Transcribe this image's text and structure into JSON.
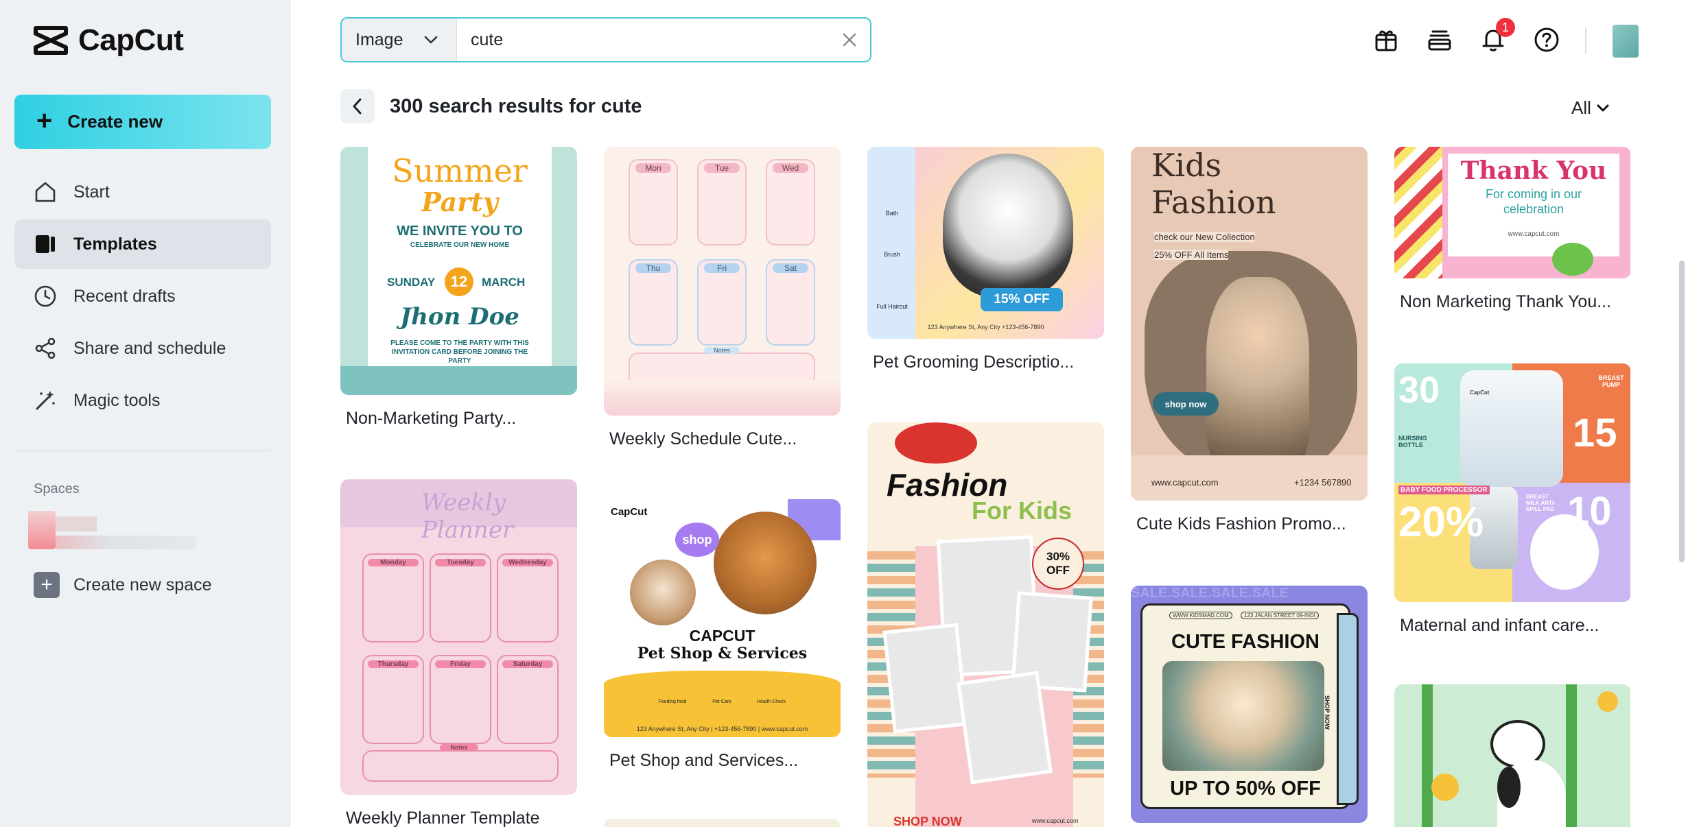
{
  "app": {
    "name": "CapCut"
  },
  "sidebar": {
    "create_label": "Create new",
    "items": [
      {
        "label": "Start",
        "icon": "home-icon"
      },
      {
        "label": "Templates",
        "icon": "templates-icon",
        "active": true
      },
      {
        "label": "Recent drafts",
        "icon": "clock-icon"
      },
      {
        "label": "Share and schedule",
        "icon": "share-icon"
      },
      {
        "label": "Magic tools",
        "icon": "magic-wand-icon"
      }
    ],
    "spaces_title": "Spaces",
    "new_space_label": "Create new space"
  },
  "search": {
    "type_label": "Image",
    "query": "cute"
  },
  "header": {
    "notification_count": "1"
  },
  "results": {
    "title": "300 search results for cute",
    "filter_label": "All"
  },
  "colors": {
    "accent": "#2fd0e3",
    "badge": "#f0303f"
  },
  "cards": [
    {
      "caption": "Non-Marketing Party...",
      "t1": "Summer",
      "t2": "Party",
      "t3": "WE INVITE YOU TO",
      "t4": "CELEBRATE OUR NEW HOME",
      "t5": "SUNDAY",
      "t6": "12",
      "t7": "MARCH",
      "t8": "Jhon Doe",
      "t9": "PLEASE COME TO THE PARTY WITH THIS INVITATION CARD BEFORE JOINING THE PARTY"
    },
    {
      "caption": "Weekly Planner Template",
      "t1": "Weekly Planner",
      "days": [
        "Monday",
        "Tuesday",
        "Wednesday",
        "Thursday",
        "Friday",
        "Saturday"
      ],
      "notes": "Notes"
    },
    {
      "caption": "Weekly Schedule Cute...",
      "days": [
        "Mon",
        "Tue",
        "Wed",
        "Thu",
        "Fri",
        "Sat"
      ],
      "notes": "Notes"
    },
    {
      "caption": "Pet Shop and Services...",
      "brand": "CapCut",
      "t1": "shop",
      "t2": "CAPCUT",
      "t3": "Pet Shop & Services",
      "services": [
        "Feeding food",
        "Pet Care",
        "Health Check"
      ],
      "footer": "123 Anywhere St, Any City  |  +123-456-7890  |  www.capcut.com"
    },
    {
      "caption": "Pet Grooming Descriptio...",
      "services": [
        "Bath",
        "Brush",
        "Full Haircut"
      ],
      "t1": "15% OFF",
      "footer": "123 Anywhere St, Any City   +123-456-7890"
    },
    {
      "caption": "",
      "t1": "Fashion",
      "t2": "For Kids",
      "t3": "30% OFF",
      "t4": "SHOP NOW",
      "t5": "www.capcut.com"
    },
    {
      "caption": "Cute Kids Fashion Promo...",
      "t1": "Kids",
      "t2": "Fashion",
      "t3": "check our New Collection",
      "t4": "25% OFF All Items",
      "t5": "shop now",
      "t6": "www.capcut.com",
      "t7": "+1234 567890"
    },
    {
      "caption": "",
      "t1": "CUTE FASHION",
      "t2": "UP TO 50% OFF",
      "t3": "SHOP NOW",
      "t4": "SALE.SALE.SALE.SALE",
      "t5": "WWW.KIDSMAD.COM",
      "t6": "123 JALAN STREET 09-INDI"
    },
    {
      "caption": "Non Marketing Thank You...",
      "t1": "Thank You",
      "t2": "For coming in our celebration",
      "t3": "www.capcut.com"
    },
    {
      "caption": "Maternal and infant care...",
      "t1": "30",
      "t2": "15",
      "t3": "20%",
      "t4": "10",
      "t5": "NURSING BOTTLE",
      "t6": "BREAST PUMP",
      "t7": "BABY FOOD PROCESSOR",
      "t8": "BREAST MILK ANTI-SPILL PAD",
      "t9": "CapCut"
    },
    {
      "caption": ""
    }
  ]
}
